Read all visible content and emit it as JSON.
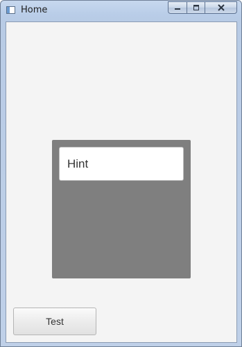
{
  "window": {
    "title": "Home",
    "icon": "java-window-icon",
    "controls": {
      "minimize_icon": "minimize-icon",
      "maximize_icon": "maximize-icon",
      "close_icon": "close-icon"
    }
  },
  "content": {
    "background": "#f4f4f4",
    "panel": {
      "color": "#7f7f7f",
      "field": {
        "placeholder": "Hint",
        "value": ""
      }
    },
    "test_button": {
      "label": "Test"
    }
  }
}
